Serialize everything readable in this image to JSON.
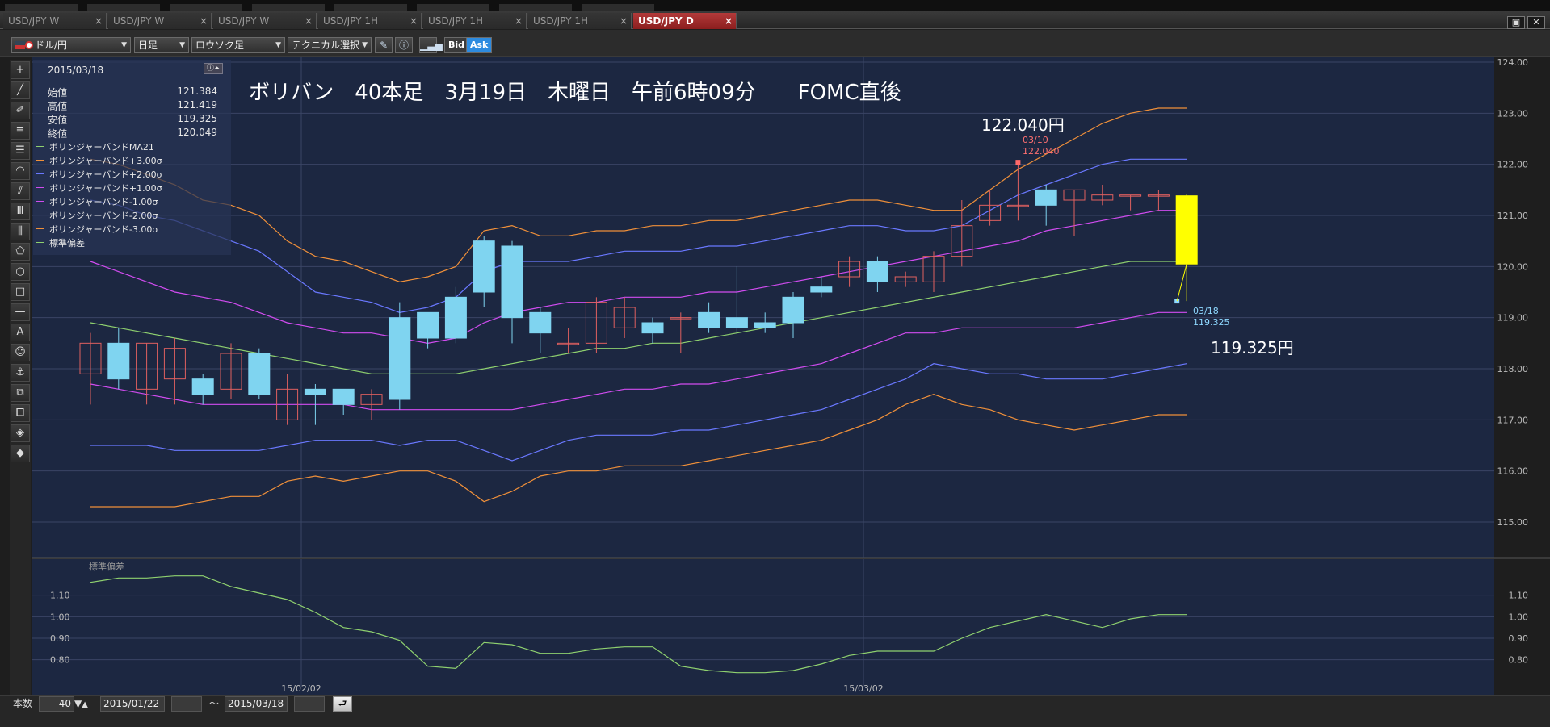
{
  "tabs": [
    {
      "label": "USD/JPY W",
      "active": false
    },
    {
      "label": "USD/JPY W",
      "active": false
    },
    {
      "label": "USD/JPY W",
      "active": false
    },
    {
      "label": "USD/JPY 1H",
      "active": false
    },
    {
      "label": "USD/JPY 1H",
      "active": false
    },
    {
      "label": "USD/JPY 1H",
      "active": false
    },
    {
      "label": "USD/JPY D",
      "active": true
    }
  ],
  "tab_close": "×",
  "window_buttons": {
    "restore": "▣",
    "close": "✕"
  },
  "toolbar": {
    "currency": "ドル/円",
    "period": "日足",
    "chart_type": "ロウソク足",
    "technical": "テクニカル選択",
    "pen_icon": "✎",
    "info_icon": "ⓘ",
    "bid": "Bid",
    "ask": "Ask"
  },
  "tools": [
    "+",
    "╱",
    "✐",
    "≡",
    "☰",
    "◠",
    "⫽",
    "Ⅲ",
    "⫼",
    "⬠",
    "○",
    "□",
    "—",
    "A",
    "☺",
    "⚓",
    "⧉",
    "⧠",
    "◈",
    "◆"
  ],
  "info_panel": {
    "date": "2015/03/18",
    "toggle": "ⓘ⏶",
    "ohlc": [
      {
        "label": "始値",
        "value": "121.384"
      },
      {
        "label": "高値",
        "value": "121.419"
      },
      {
        "label": "安値",
        "value": "119.325"
      },
      {
        "label": "終値",
        "value": "120.049"
      }
    ],
    "indicators": [
      {
        "label": "ボリンジャーバンドMA21",
        "color": "#8fd16f"
      },
      {
        "label": "ボリンジャーバンド+3.00σ",
        "color": "#f0903a"
      },
      {
        "label": "ボリンジャーバンド+2.00σ",
        "color": "#6a78ff"
      },
      {
        "label": "ボリンジャーバンド+1.00σ",
        "color": "#d14cf0"
      },
      {
        "label": "ボリンジャーバンド-1.00σ",
        "color": "#d14cf0"
      },
      {
        "label": "ボリンジャーバンド-2.00σ",
        "color": "#6a78ff"
      },
      {
        "label": "ボリンジャーバンド-3.00σ",
        "color": "#f0903a"
      },
      {
        "label": "標準偏差",
        "color": "#8fd16f"
      }
    ]
  },
  "annotations": {
    "title": "ボリバン　40本足　3月19日　木曜日　午前6時09分　　FOMC直後",
    "high_label": "122.040円",
    "low_label": "119.325円",
    "high_marker": {
      "date": "03/10",
      "value": "122.040"
    },
    "low_marker": {
      "date": "03/18",
      "value": "119.325"
    }
  },
  "sub_panel_label": "標準偏差",
  "colors": {
    "up": "#7fd4f0",
    "down_border": "#e06060",
    "highlight": "#ffff00"
  },
  "chart_data": {
    "type": "candlestick",
    "price_axis": {
      "min": 115,
      "max": 124,
      "ticks": [
        "115.00",
        "116.00",
        "117.00",
        "118.00",
        "119.00",
        "120.00",
        "121.00",
        "122.00",
        "123.00",
        "124.00"
      ]
    },
    "x_ticks": [
      {
        "label": "15/02/02",
        "index": 7.5
      },
      {
        "label": "15/03/02",
        "index": 27.5
      }
    ],
    "candles": [
      [
        118.5,
        118.7,
        117.3,
        117.9
      ],
      [
        117.8,
        118.8,
        117.6,
        118.5
      ],
      [
        118.5,
        118.5,
        117.3,
        117.6
      ],
      [
        118.4,
        118.6,
        117.3,
        117.8
      ],
      [
        117.5,
        117.9,
        117.3,
        117.8
      ],
      [
        118.3,
        118.5,
        117.4,
        117.6
      ],
      [
        117.5,
        118.4,
        117.4,
        118.3
      ],
      [
        117.6,
        117.9,
        116.9,
        117.0
      ],
      [
        117.5,
        117.7,
        116.9,
        117.6
      ],
      [
        117.3,
        117.6,
        117.1,
        117.6
      ],
      [
        117.5,
        117.6,
        117.0,
        117.3
      ],
      [
        117.4,
        119.3,
        117.2,
        119.0
      ],
      [
        118.6,
        119.1,
        118.4,
        119.1
      ],
      [
        118.6,
        119.6,
        118.5,
        119.4
      ],
      [
        119.5,
        120.6,
        119.2,
        120.5
      ],
      [
        119.0,
        120.5,
        118.5,
        120.4
      ],
      [
        118.7,
        119.2,
        118.3,
        119.1
      ],
      [
        118.5,
        118.8,
        118.3,
        118.5
      ],
      [
        119.3,
        119.4,
        118.3,
        118.5
      ],
      [
        119.2,
        119.4,
        118.6,
        118.8
      ],
      [
        118.7,
        119.0,
        118.5,
        118.9
      ],
      [
        119.0,
        119.1,
        118.3,
        119.0
      ],
      [
        118.8,
        119.3,
        118.7,
        119.1
      ],
      [
        118.8,
        120.0,
        118.7,
        119.0
      ],
      [
        118.8,
        119.1,
        118.7,
        118.9
      ],
      [
        118.9,
        119.5,
        118.6,
        119.4
      ],
      [
        119.5,
        119.8,
        119.4,
        119.6
      ],
      [
        120.1,
        120.2,
        119.6,
        119.8
      ],
      [
        119.7,
        120.2,
        119.5,
        120.1
      ],
      [
        119.8,
        119.9,
        119.6,
        119.7
      ],
      [
        120.2,
        120.3,
        119.5,
        119.7
      ],
      [
        120.8,
        121.3,
        120.0,
        120.2
      ],
      [
        121.2,
        121.5,
        120.8,
        120.9
      ],
      [
        121.2,
        122.04,
        120.9,
        121.2
      ],
      [
        121.2,
        121.6,
        120.8,
        121.5
      ],
      [
        121.5,
        121.5,
        120.6,
        121.3
      ],
      [
        121.4,
        121.6,
        121.2,
        121.3
      ],
      [
        121.4,
        121.4,
        121.1,
        121.4
      ],
      [
        121.4,
        121.5,
        121.1,
        121.4
      ],
      [
        121.384,
        121.419,
        119.325,
        120.049
      ]
    ],
    "bands": {
      "upper3": [
        122.1,
        122.0,
        121.8,
        121.6,
        121.3,
        121.2,
        121.0,
        120.5,
        120.2,
        120.1,
        119.9,
        119.7,
        119.8,
        120.0,
        120.7,
        120.8,
        120.6,
        120.6,
        120.7,
        120.7,
        120.8,
        120.8,
        120.9,
        120.9,
        121.0,
        121.1,
        121.2,
        121.3,
        121.3,
        121.2,
        121.1,
        121.1,
        121.5,
        121.9,
        122.2,
        122.5,
        122.8,
        123.0,
        123.1,
        123.1
      ],
      "upper2": [
        121.3,
        121.2,
        121.0,
        120.9,
        120.7,
        120.5,
        120.3,
        119.9,
        119.5,
        119.4,
        119.3,
        119.1,
        119.2,
        119.4,
        119.9,
        120.1,
        120.1,
        120.1,
        120.2,
        120.3,
        120.3,
        120.3,
        120.4,
        120.4,
        120.5,
        120.6,
        120.7,
        120.8,
        120.8,
        120.7,
        120.7,
        120.8,
        121.1,
        121.4,
        121.6,
        121.8,
        122.0,
        122.1,
        122.1,
        122.1
      ],
      "upper1": [
        120.1,
        119.9,
        119.7,
        119.5,
        119.4,
        119.3,
        119.1,
        118.9,
        118.8,
        118.7,
        118.7,
        118.6,
        118.5,
        118.6,
        118.9,
        119.1,
        119.2,
        119.3,
        119.3,
        119.4,
        119.4,
        119.4,
        119.5,
        119.5,
        119.6,
        119.7,
        119.8,
        119.9,
        120.0,
        120.1,
        120.2,
        120.3,
        120.4,
        120.5,
        120.7,
        120.8,
        120.9,
        121.0,
        121.1,
        121.1
      ],
      "mid": [
        118.9,
        118.8,
        118.7,
        118.6,
        118.5,
        118.4,
        118.3,
        118.2,
        118.1,
        118.0,
        117.9,
        117.9,
        117.9,
        117.9,
        118.0,
        118.1,
        118.2,
        118.3,
        118.4,
        118.4,
        118.5,
        118.5,
        118.6,
        118.7,
        118.8,
        118.9,
        119.0,
        119.1,
        119.2,
        119.3,
        119.4,
        119.5,
        119.6,
        119.7,
        119.8,
        119.9,
        120.0,
        120.1,
        120.1,
        120.1
      ],
      "lower1": [
        117.7,
        117.6,
        117.5,
        117.4,
        117.3,
        117.3,
        117.3,
        117.3,
        117.3,
        117.3,
        117.2,
        117.2,
        117.2,
        117.2,
        117.2,
        117.2,
        117.3,
        117.4,
        117.5,
        117.6,
        117.6,
        117.7,
        117.7,
        117.8,
        117.9,
        118.0,
        118.1,
        118.3,
        118.5,
        118.7,
        118.7,
        118.8,
        118.8,
        118.8,
        118.8,
        118.8,
        118.9,
        119.0,
        119.1,
        119.1
      ],
      "lower2": [
        116.5,
        116.5,
        116.5,
        116.4,
        116.4,
        116.4,
        116.4,
        116.5,
        116.6,
        116.6,
        116.6,
        116.5,
        116.6,
        116.6,
        116.4,
        116.2,
        116.4,
        116.6,
        116.7,
        116.7,
        116.7,
        116.8,
        116.8,
        116.9,
        117.0,
        117.1,
        117.2,
        117.4,
        117.6,
        117.8,
        118.1,
        118.0,
        117.9,
        117.9,
        117.8,
        117.8,
        117.8,
        117.9,
        118.0,
        118.1
      ],
      "lower3": [
        115.3,
        115.3,
        115.3,
        115.3,
        115.4,
        115.5,
        115.5,
        115.8,
        115.9,
        115.8,
        115.9,
        116.0,
        116.0,
        115.8,
        115.4,
        115.6,
        115.9,
        116.0,
        116.0,
        116.1,
        116.1,
        116.1,
        116.2,
        116.3,
        116.4,
        116.5,
        116.6,
        116.8,
        117.0,
        117.3,
        117.5,
        117.3,
        117.2,
        117.0,
        116.9,
        116.8,
        116.9,
        117.0,
        117.1,
        117.1
      ]
    },
    "std_axis": {
      "min": 0.75,
      "max": 1.2,
      "ticks": [
        "0.80",
        "0.90",
        "1.00",
        "1.10"
      ]
    },
    "std_dev": [
      1.16,
      1.18,
      1.18,
      1.19,
      1.19,
      1.14,
      1.11,
      1.08,
      1.02,
      0.95,
      0.93,
      0.89,
      0.77,
      0.76,
      0.88,
      0.87,
      0.83,
      0.83,
      0.85,
      0.86,
      0.86,
      0.77,
      0.75,
      0.74,
      0.74,
      0.75,
      0.78,
      0.82,
      0.84,
      0.84,
      0.84,
      0.9,
      0.95,
      0.98,
      1.01,
      0.98,
      0.95,
      0.99,
      1.01,
      1.01
    ]
  },
  "bottom_bar": {
    "count_label": "本数",
    "count_value": "40",
    "from_date": "2015/01/22",
    "tilde": "～",
    "to_date": "2015/03/18",
    "go_icon": "⮐"
  }
}
